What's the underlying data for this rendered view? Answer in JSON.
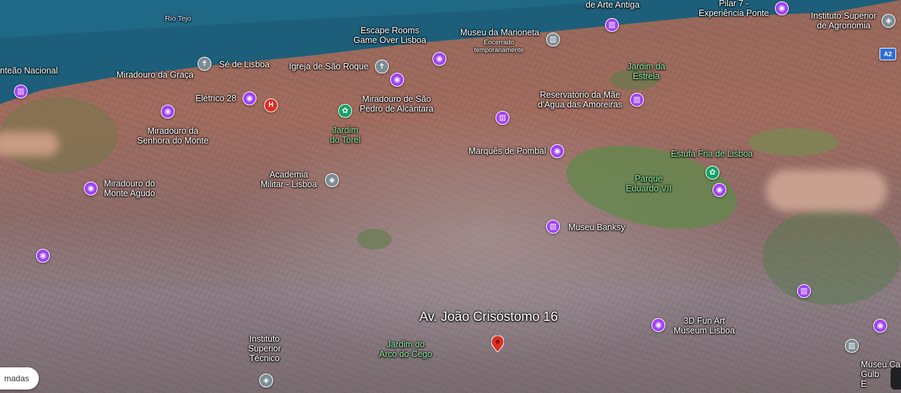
{
  "map": {
    "colors": {
      "water": "#1d5f7a",
      "city": "#a36d5f",
      "park": "#5f8a4a",
      "poi": "#a142f4",
      "label": "#ffffff",
      "green_label": "#8ef0a6",
      "target_pin": "#d93025"
    },
    "water_label": "Rio Tejo",
    "destination": {
      "label": "Av. João Crisóstomo 16",
      "icon": "red-location-pin-icon"
    },
    "labels": {
      "arte_antiga": "de Arte Antiga",
      "pilar7": "Pilar 7 -\nExperiência Ponte",
      "agronomia": "Instituto Superior\nde Agronomia",
      "escape": "Escape Rooms\nGame Over Lisboa",
      "marioneta": "Museu da Marioneta",
      "marioneta_note": "Encerrado\ntemporariamente",
      "panteao": "nteão Nacional",
      "graca": "Miradouro da Graça",
      "se": "Sé de Lisboa",
      "roque": "Igreja de São Roque",
      "estrela": "Jardim da\nEstrela",
      "eletrico": "Elétrico 28",
      "sao_pedro": "Miradouro de São\nPedro de Alcântara",
      "reservatorio": "Reservatório da Mãe\nd'Água das Amoreiras",
      "senhora_monte": "Miradouro da\nSenhora do Monte",
      "torel": "Jardim\ndo Torel",
      "pombal": "Marquês de Pombal",
      "estufa": "Estufa Fria de Lisboa",
      "academia": "Academia\nMilitar - Lisboa",
      "parque": "Parque\nEduardo VII",
      "monte_agudo": "Miradouro do\nMonte Agudo",
      "banksy": "Museu Banksy",
      "fun_art": "3D Fun Art\nMuseum Lisboa",
      "tecnico": "Instituto\nSuperior\nTécnico",
      "arco_cego": "Jardim do\nArco do Cego",
      "museu_cg": "Museu Ca\nGulb\nE"
    },
    "road_shield": "A2",
    "pin_glyphs": {
      "camera": "◉",
      "museum": "▥",
      "cross": "✝",
      "flower": "✿",
      "school": "◈",
      "hospital": "H"
    }
  },
  "chip": {
    "label": "madas"
  }
}
